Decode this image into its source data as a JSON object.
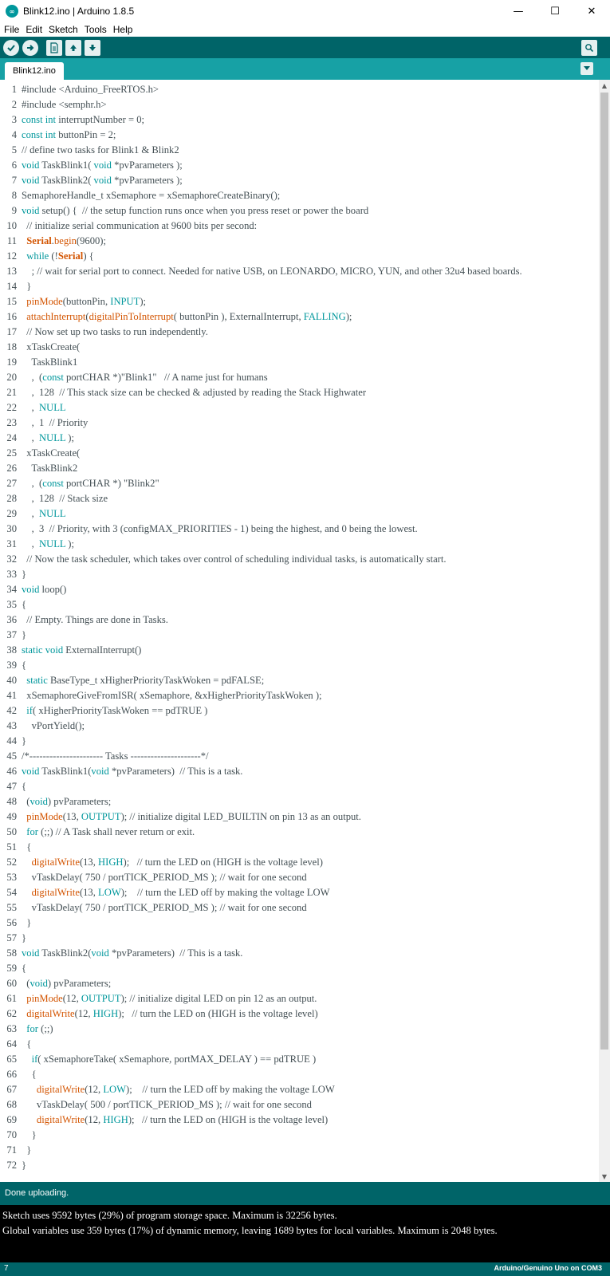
{
  "window": {
    "title": "Blink12.ino | Arduino 1.8.5",
    "minimize": "—",
    "maximize": "☐",
    "close": "✕"
  },
  "menu": [
    "File",
    "Edit",
    "Sketch",
    "Tools",
    "Help"
  ],
  "toolbar": {
    "icons": [
      "verify-icon",
      "upload-icon",
      "new-icon",
      "open-icon",
      "save-icon"
    ],
    "serial_icon": "serial-monitor-icon"
  },
  "tabs": [
    {
      "label": "Blink12.ino"
    }
  ],
  "editor": {
    "lines": [
      "#include <Arduino_FreeRTOS.h>",
      "#include <semphr.h>",
      "const int interruptNumber = 0;",
      "const int buttonPin = 2;",
      "// define two tasks for Blink1 & Blink2",
      "void TaskBlink1( void *pvParameters );",
      "void TaskBlink2( void *pvParameters );",
      "SemaphoreHandle_t xSemaphore = xSemaphoreCreateBinary();",
      "void setup() {  // the setup function runs once when you press reset or power the board",
      "  // initialize serial communication at 9600 bits per second:",
      "  Serial.begin(9600);",
      "  while (!Serial) {",
      "    ; // wait for serial port to connect. Needed for native USB, on LEONARDO, MICRO, YUN, and other 32u4 based boards.",
      "  }",
      "  pinMode(buttonPin, INPUT);",
      "  attachInterrupt(digitalPinToInterrupt( buttonPin ), ExternalInterrupt, FALLING);",
      "  // Now set up two tasks to run independently.",
      "  xTaskCreate(",
      "    TaskBlink1",
      "    ,  (const portCHAR *)\"Blink1\"   // A name just for humans",
      "    ,  128  // This stack size can be checked & adjusted by reading the Stack Highwater",
      "    ,  NULL",
      "    ,  1  // Priority",
      "    ,  NULL );",
      "  xTaskCreate(",
      "    TaskBlink2",
      "    ,  (const portCHAR *) \"Blink2\"",
      "    ,  128  // Stack size",
      "    ,  NULL",
      "    ,  3  // Priority, with 3 (configMAX_PRIORITIES - 1) being the highest, and 0 being the lowest.",
      "    ,  NULL );",
      "  // Now the task scheduler, which takes over control of scheduling individual tasks, is automatically start.",
      "}",
      "void loop()",
      "{",
      "  // Empty. Things are done in Tasks.",
      "}",
      "static void ExternalInterrupt()",
      "{",
      "  static BaseType_t xHigherPriorityTaskWoken = pdFALSE;",
      "  xSemaphoreGiveFromISR( xSemaphore, &xHigherPriorityTaskWoken );",
      "  if( xHigherPriorityTaskWoken == pdTRUE )",
      "    vPortYield();",
      "}",
      "/*---------------------- Tasks ---------------------*/",
      "void TaskBlink1(void *pvParameters)  // This is a task.",
      "{",
      "  (void) pvParameters;",
      "  pinMode(13, OUTPUT); // initialize digital LED_BUILTIN on pin 13 as an output.",
      "  for (;;) // A Task shall never return or exit.",
      "  {",
      "    digitalWrite(13, HIGH);   // turn the LED on (HIGH is the voltage level)",
      "    vTaskDelay( 750 / portTICK_PERIOD_MS ); // wait for one second",
      "    digitalWrite(13, LOW);    // turn the LED off by making the voltage LOW",
      "    vTaskDelay( 750 / portTICK_PERIOD_MS ); // wait for one second",
      "  }",
      "}",
      "void TaskBlink2(void *pvParameters)  // This is a task.",
      "{",
      "  (void) pvParameters;",
      "  pinMode(12, OUTPUT); // initialize digital LED on pin 12 as an output.",
      "  digitalWrite(12, HIGH);   // turn the LED on (HIGH is the voltage level)",
      "  for (;;)",
      "  {",
      "    if( xSemaphoreTake( xSemaphore, portMAX_DELAY ) == pdTRUE )",
      "    {",
      "      digitalWrite(12, LOW);    // turn the LED off by making the voltage LOW",
      "      vTaskDelay( 500 / portTICK_PERIOD_MS ); // wait for one second",
      "      digitalWrite(12, HIGH);   // turn the LED on (HIGH is the voltage level)",
      "    }",
      "  }",
      "}"
    ]
  },
  "status": {
    "message": "Done uploading."
  },
  "console": {
    "lines": [
      "Sketch uses 9592 bytes (29%) of program storage space. Maximum is 32256 bytes.",
      "Global variables use 359 bytes (17%) of dynamic memory, leaving 1689 bytes for local variables. Maximum is 2048 bytes."
    ]
  },
  "footer": {
    "line_number": "7",
    "board": "Arduino/Genuino Uno on COM3"
  },
  "colors": {
    "teal_dark": "#006468",
    "teal_tab": "#17a1a5",
    "keyword": "#00979c",
    "function": "#d35400"
  }
}
